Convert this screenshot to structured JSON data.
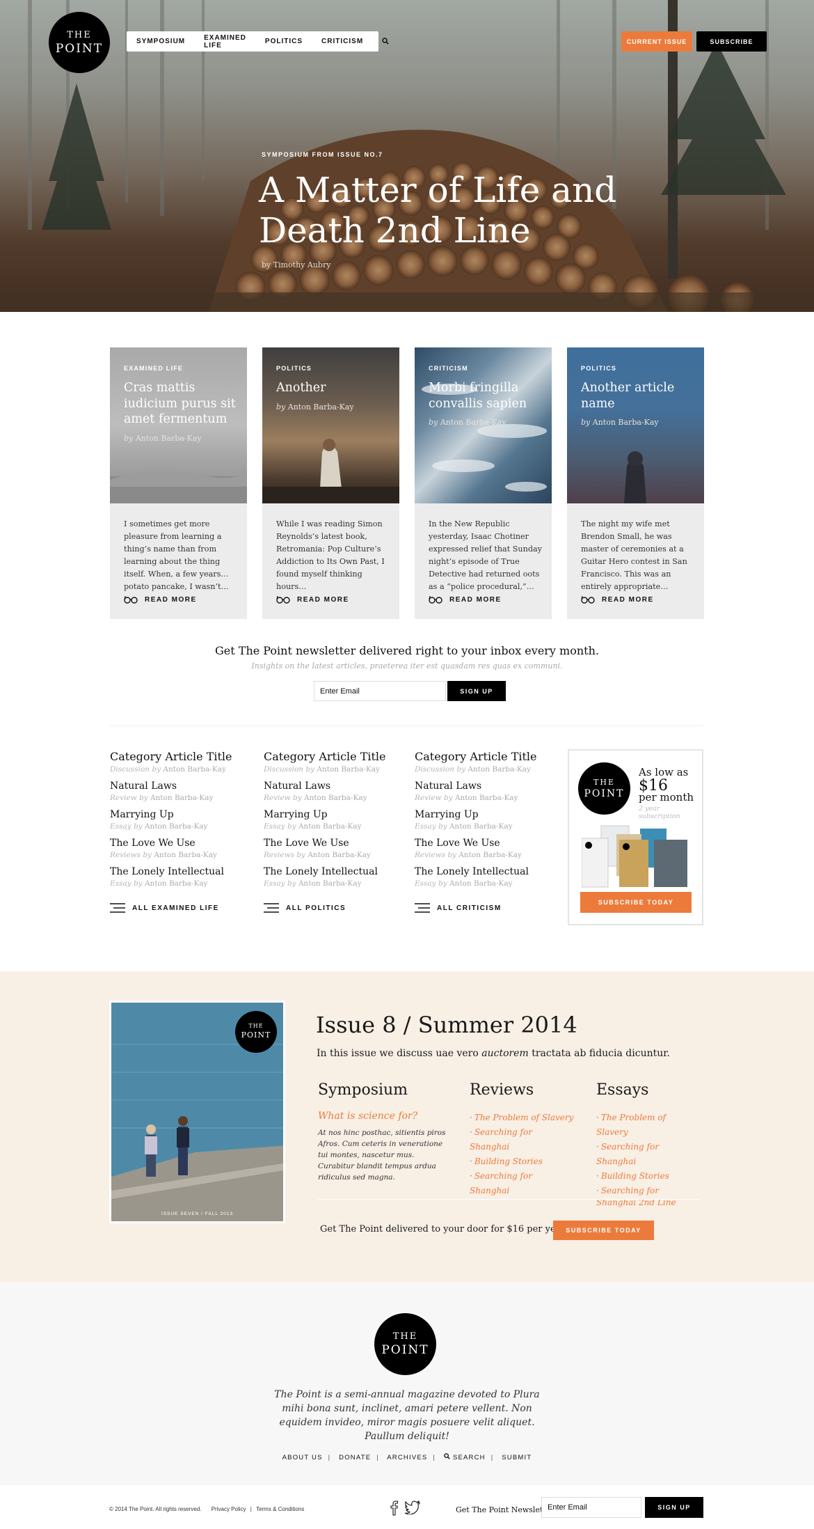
{
  "brand": {
    "logo_line1": "THE",
    "logo_line2": "POINT"
  },
  "nav": {
    "items": [
      "SYMPOSIUM",
      "EXAMINED LIFE",
      "POLITICS",
      "CRITICISM"
    ],
    "search_icon": "search-icon"
  },
  "header_buttons": {
    "current_issue": "CURRENT ISSUE",
    "subscribe": "SUBSCRIBE"
  },
  "colors": {
    "accent": "#ec7b3b",
    "black": "#000000",
    "issue_bg": "#f8efe5"
  },
  "hero": {
    "kicker": "SYMPOSIUM FROM ISSUE NO.7",
    "title": "A Matter of Life and Death 2nd Line",
    "byline": "by  Timothy Aubry"
  },
  "cards": [
    {
      "category": "EXAMINED LIFE",
      "title": "Cras mattis iudicium purus sit amet fermentum",
      "by": "by",
      "author": "Anton Barba-Kay",
      "excerpt": "I sometimes get more pleasure from learning a thing’s name than from learning about the thing itself. When, a few years… potato pancake, I wasn’t…",
      "more": "READ MORE"
    },
    {
      "category": "POLITICS",
      "title": "Another",
      "by": "by",
      "author": "Anton Barba-Kay",
      "excerpt": "While I was reading Simon Reynolds’s latest book, Retromania: Pop Culture’s Addiction to Its Own Past, I found myself thinking hours…",
      "more": "READ MORE"
    },
    {
      "category": "CRITICISM",
      "title": "Morbi fringilla convallis sapien",
      "by": "by",
      "author": "Anton Barba-Kay",
      "excerpt": "In the New Republic yesterday, Isaac Chotiner expressed relief that Sunday night’s episode of True Detective had returned oots as a “police procedural,”…",
      "more": "READ MORE"
    },
    {
      "category": "POLITICS",
      "title": "Another article name",
      "by": "by",
      "author": "Anton Barba-Kay",
      "excerpt": "The night my wife met Brendon Small, he was master of ceremonies at a Guitar Hero contest in San Francisco. This was an entirely appropriate…",
      "more": "READ MORE"
    }
  ],
  "newsletter": {
    "title": "Get The Point newsletter delivered right to your inbox every month.",
    "subtitle": "Insights on the latest articles, praeterea iter est quasdam res quas ex communi.",
    "input_value": "Enter Email",
    "button": "SIGN UP"
  },
  "categories": [
    {
      "heading": "Category Article Title",
      "heading_type": "Discussion by",
      "heading_author": "Anton Barba-Kay",
      "items": [
        {
          "title": "Natural Laws",
          "type": "Review by",
          "author": "Anton Barba-Kay"
        },
        {
          "title": "Marrying Up",
          "type": "Essay by",
          "author": "Anton Barba-Kay"
        },
        {
          "title": "The Love We Use",
          "type": "Reviews by",
          "author": "Anton Barba-Kay"
        },
        {
          "title": "The Lonely Intellectual",
          "type": "Essay by",
          "author": "Anton Barba-Kay"
        }
      ],
      "all_link": "ALL EXAMINED LIFE"
    },
    {
      "heading": "Category Article Title",
      "heading_type": "Discussion by",
      "heading_author": "Anton Barba-Kay",
      "items": [
        {
          "title": "Natural Laws",
          "type": "Review by",
          "author": "Anton Barba-Kay"
        },
        {
          "title": "Marrying Up",
          "type": "Essay by",
          "author": "Anton Barba-Kay"
        },
        {
          "title": "The Love We Use",
          "type": "Reviews by",
          "author": "Anton Barba-Kay"
        },
        {
          "title": "The Lonely Intellectual",
          "type": "Essay by",
          "author": "Anton Barba-Kay"
        }
      ],
      "all_link": "ALL POLITICS"
    },
    {
      "heading": "Category Article Title",
      "heading_type": "Discussion by",
      "heading_author": "Anton Barba-Kay",
      "items": [
        {
          "title": "Natural Laws",
          "type": "Review by",
          "author": "Anton Barba-Kay"
        },
        {
          "title": "Marrying Up",
          "type": "Essay by",
          "author": "Anton Barba-Kay"
        },
        {
          "title": "The Love We Use",
          "type": "Reviews by",
          "author": "Anton Barba-Kay"
        },
        {
          "title": "The Lonely Intellectual",
          "type": "Essay by",
          "author": "Anton Barba-Kay"
        }
      ],
      "all_link": "ALL CRITICISM"
    }
  ],
  "promo": {
    "line1": "As low as",
    "price": "$16",
    "line3": "per month",
    "note": "2 year subscription",
    "button": "SUBSCRIBE TODAY"
  },
  "issue": {
    "cover_footer": "ISSUE SEVEN / FALL 2013",
    "title": "Issue 8  /  Summer 2014",
    "desc_before": "In this issue we discuss uae vero ",
    "desc_em": "auctorem",
    "desc_after": " tractata ab fiducia dicuntur.",
    "symposium": {
      "heading": "Symposium",
      "question": "What is science for?",
      "text": "At nos hinc posthac, sitientis piros Afros. Cum ceteris in veneratione tui montes, nascetur mus. Curabitur blandit tempus ardua ridiculus sed magna."
    },
    "reviews": {
      "heading": "Reviews",
      "items": [
        "The Problem of Slavery",
        "Searching for Shanghai",
        "Building Stories",
        "Searching for Shanghai"
      ]
    },
    "essays": {
      "heading": "Essays",
      "items": [
        "The Problem of Slavery",
        "Searching for Shanghai",
        "Building Stories",
        "Searching for Shanghai 2nd Line"
      ]
    },
    "cta": "Get The Point delivered to your door for $16 per year",
    "button": "SUBSCRIBE TODAY"
  },
  "footer": {
    "about": "The Point is a semi-annual magazine devoted to Plura mihi bona sunt, inclinet, amari petere vellent. Non equidem invideo, miror magis posuere velit aliquet. Paullum deliquit!",
    "links": [
      "ABOUT US",
      "DONATE",
      "ARCHIVES",
      "SEARCH",
      "SUBMIT"
    ],
    "copyright": "© 2014 The Point. All rights reserved.",
    "privacy": "Privacy Policy",
    "terms": "Terms & Conditions",
    "newsletter_label": "Get The Point Newsletter",
    "input_value": "Enter Email",
    "button": "SIGN UP"
  }
}
